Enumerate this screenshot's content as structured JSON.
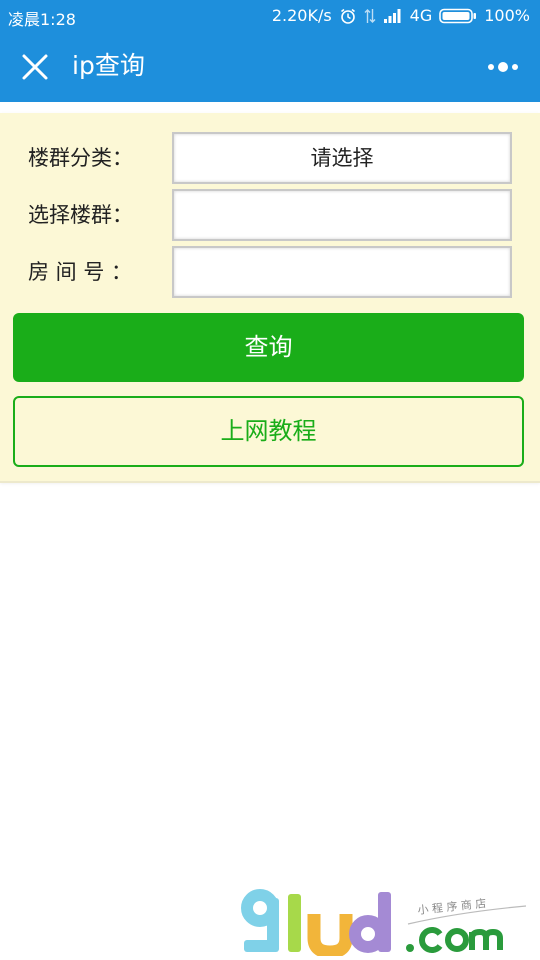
{
  "status_bar": {
    "time": "凌晨1:28",
    "network_speed": "2.20K/s",
    "network_type": "4G",
    "battery": "100%",
    "icons": [
      "alarm-icon",
      "data-transfer-icon",
      "signal-icon",
      "battery-icon"
    ]
  },
  "nav": {
    "title": "ip查询",
    "close_icon": "close-icon",
    "more_icon": "more-icon",
    "bar_color": "#1e8fdc"
  },
  "form": {
    "background": "#fcf8d6",
    "rows": [
      {
        "label": "楼群分类：",
        "value": "请选择"
      },
      {
        "label": "选择楼群：",
        "value": ""
      },
      {
        "label": "房 间 号 ：",
        "value": ""
      }
    ]
  },
  "buttons": {
    "query_label": "查询",
    "tutorial_label": "上网教程",
    "accent": "#1aad19"
  },
  "watermark": {
    "brand": "91ud.com",
    "tagline": "小程序商店"
  }
}
